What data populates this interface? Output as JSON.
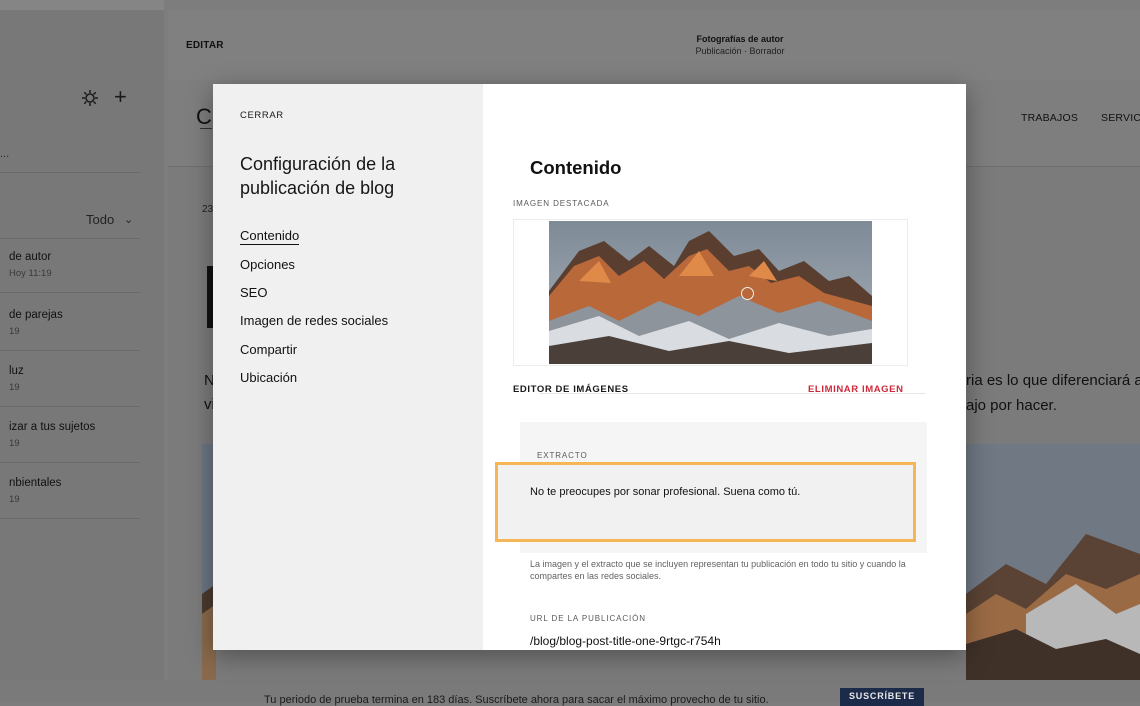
{
  "sidebar": {
    "search_partial": "...",
    "filter_label": "Todo",
    "posts": [
      {
        "title": "de autor",
        "meta": "Hoy 11:19"
      },
      {
        "title": "de parejas",
        "meta": "19"
      },
      {
        "title": "luz",
        "meta": "19"
      },
      {
        "title": "izar a tus sujetos",
        "meta": "19"
      },
      {
        "title": "nbientales",
        "meta": "19"
      }
    ]
  },
  "editor": {
    "edit_label": "EDITAR",
    "doc_title": "Fotografías de autor",
    "doc_status": "Publicación · Borrador",
    "nav": [
      "TRABAJOS",
      "SERVICI"
    ],
    "logo_fragment": "C",
    "date_fragment": "23",
    "line1_fragment": "N",
    "line2_fragment": "vi",
    "body_line_1": "ria es lo que diferenciará a",
    "body_line_2": "ajo por hacer."
  },
  "trial": {
    "text": "Tu periodo de prueba termina en 183 días. Suscríbete ahora para sacar el máximo provecho de tu sitio.",
    "subscribe_label": "SUSCRÍBETE"
  },
  "modal": {
    "close_label": "CERRAR",
    "title": "Configuración de la publicación de blog",
    "menu": [
      "Contenido",
      "Opciones",
      "SEO",
      "Imagen de redes sociales",
      "Compartir",
      "Ubicación"
    ],
    "active_index": 0,
    "section_title": "Contenido",
    "featured_image_label": "IMAGEN DESTACADA",
    "image_editor_label": "EDITOR DE IMÁGENES",
    "delete_image_label": "ELIMINAR IMAGEN",
    "excerpt_label": "EXTRACTO",
    "excerpt_value": "No te preocupes por sonar profesional. Suena como tú.",
    "help_text": "La imagen y el extracto que se incluyen representan tu publicación en todo tu sitio y cuando la compartes en las redes sociales.",
    "url_label": "URL DE LA PUBLICACIÓN",
    "url_value": "/blog/blog-post-title-one-9rtgc-r754h"
  },
  "colors": {
    "accent_highlight": "#f4b657",
    "delete_red": "#d0293b",
    "subscribe_bg": "#1d2b4a"
  }
}
